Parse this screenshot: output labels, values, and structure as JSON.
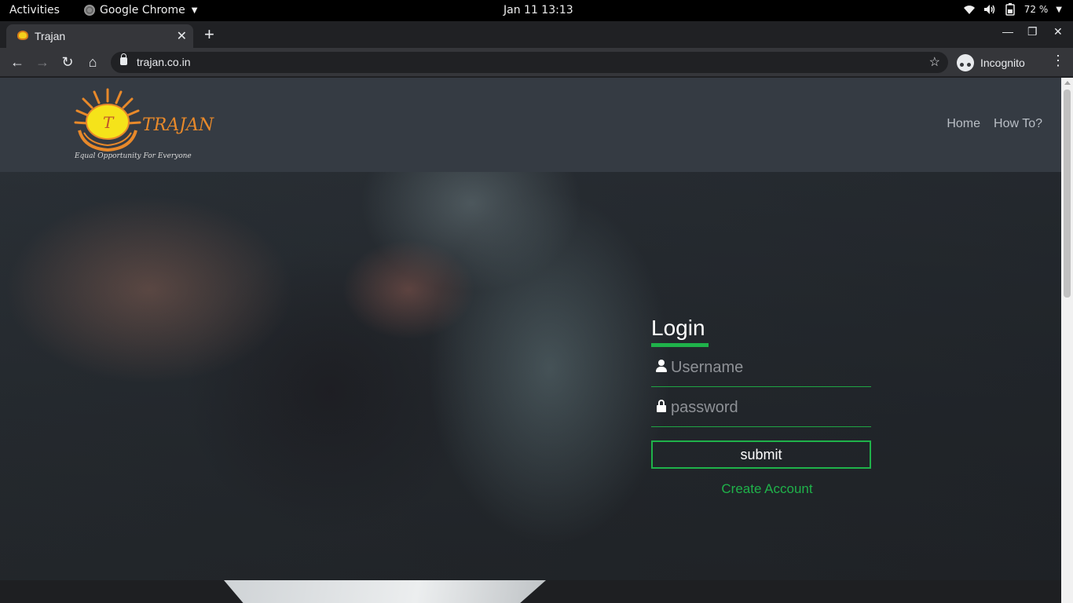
{
  "os": {
    "activities": "Activities",
    "app_name": "Google Chrome",
    "clock": "Jan 11  13:13",
    "battery": "72 %"
  },
  "browser": {
    "tab_title": "Trajan",
    "url": "trajan.co.in",
    "profile_label": "Incognito"
  },
  "site": {
    "logo_letter": "T",
    "logo_name": "TRAJAN",
    "logo_tagline": "Equal Opportunity For Everyone",
    "nav": [
      "Home",
      "How To?"
    ]
  },
  "login": {
    "heading": "Login",
    "username_placeholder": "Username",
    "password_placeholder": "password",
    "submit_label": "submit",
    "create_account_label": "Create Account"
  },
  "colors": {
    "accent": "#1fb24a",
    "header_bg": "#353b43"
  }
}
